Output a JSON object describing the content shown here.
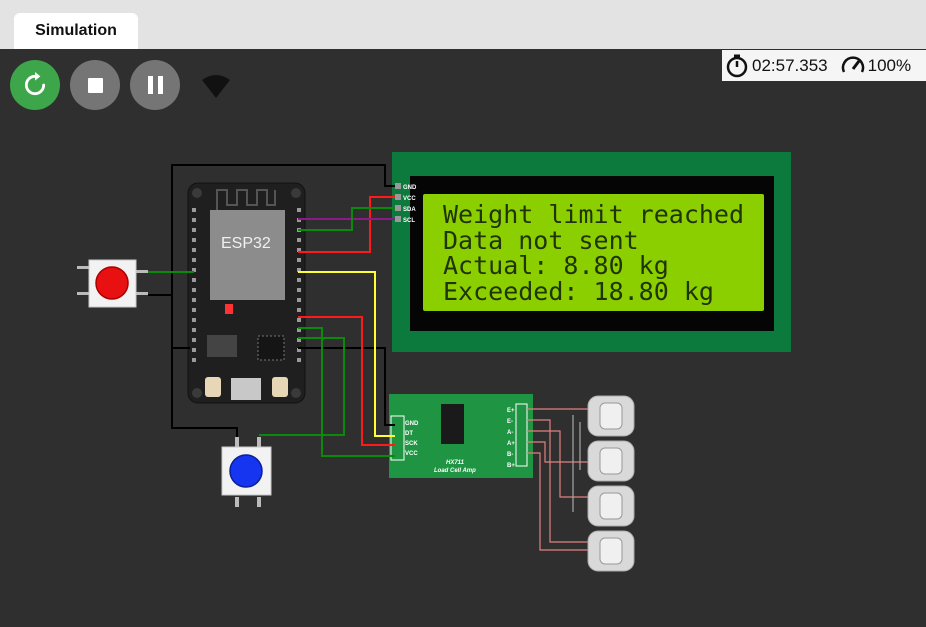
{
  "tabs": [
    {
      "label": "Simulation",
      "active": true
    }
  ],
  "toolbar": {
    "restart_icon": "restart-icon",
    "stop_icon": "stop-icon",
    "pause_icon": "pause-icon",
    "wifi_icon": "wifi-icon"
  },
  "stats": {
    "elapsed_time": "02:57.353",
    "speed": "100%"
  },
  "esp32": {
    "label": "ESP32"
  },
  "lcd": {
    "lines": [
      "Weight limit reached",
      "Data not sent",
      "Actual: 8.80 kg",
      "Exceeded: 18.80 kg"
    ],
    "pins": [
      "GND",
      "VCC",
      "SDA",
      "SCL"
    ]
  },
  "hx711": {
    "title": "HX711",
    "subtitle": "Load Cell Amp",
    "left_pins": [
      "GND",
      "DT",
      "SCK",
      "VCC"
    ],
    "right_pins": [
      "E+",
      "E-",
      "A-",
      "A+",
      "B-",
      "B+"
    ]
  },
  "colors": {
    "workspace": "#2f2f2f",
    "restart_button": "#3da54a",
    "control_button": "#757575",
    "lcd_frame": "#0c7a3c",
    "lcd_screen": "#8ccf00",
    "wire_green": "#0a8a0a",
    "wire_red": "#ff1a1a",
    "wire_yellow": "#ffff33",
    "wire_purple": "#8a1a8a",
    "wire_black": "#000000",
    "pushbutton_red": "#e81010",
    "pushbutton_blue": "#1535f0"
  }
}
